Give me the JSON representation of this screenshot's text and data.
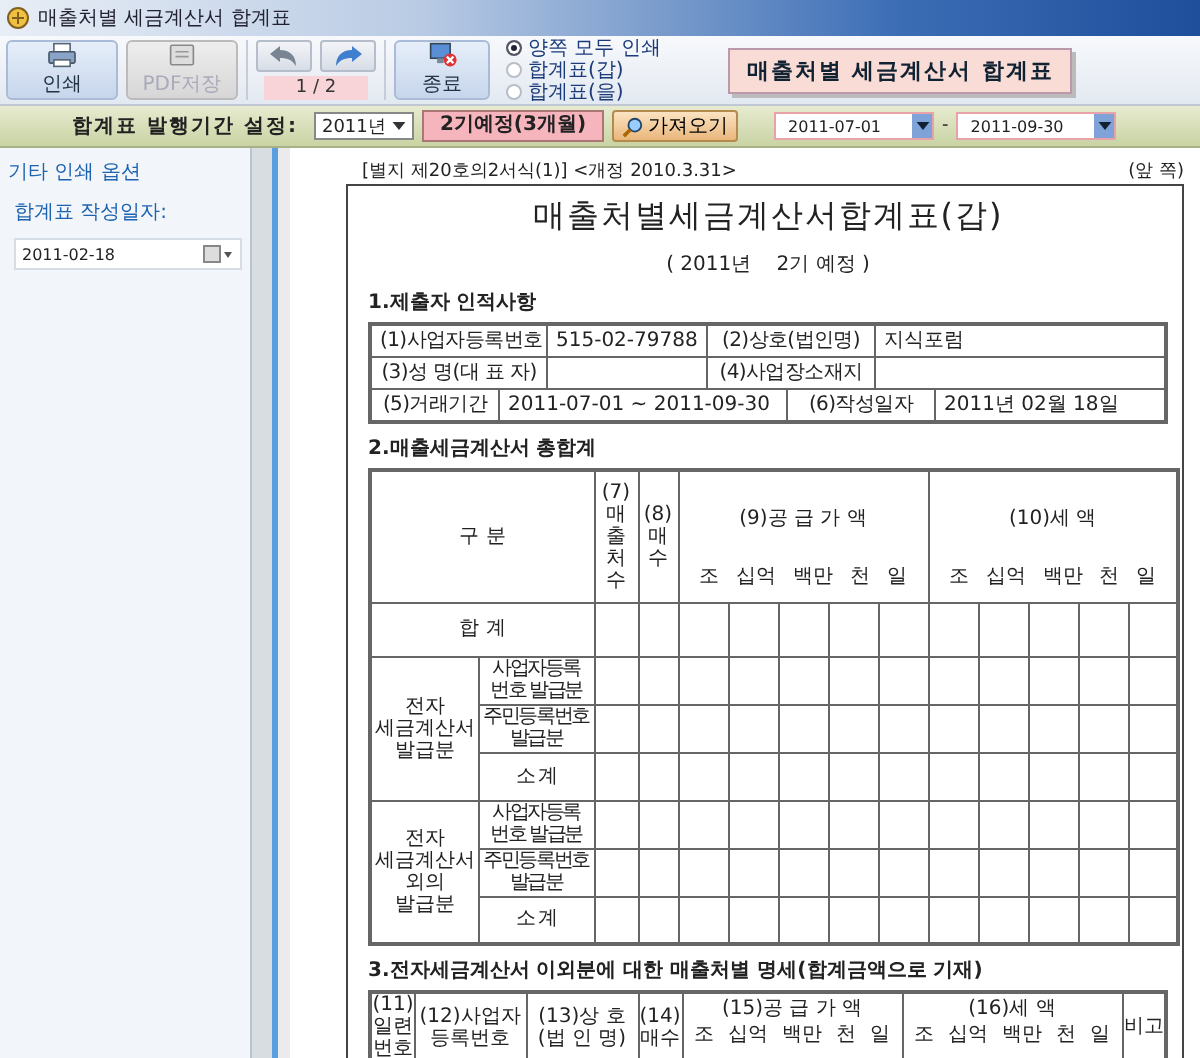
{
  "window": {
    "title": "매출처별 세금계산서 합계표"
  },
  "toolbar": {
    "print_button": {
      "label": "인쇄"
    },
    "pdf_button": {
      "label": "PDF저장",
      "disabled": true
    },
    "page_indicator": "1 / 2",
    "exit_button": {
      "label": "종료"
    },
    "print_options": [
      {
        "label": "양쪽 모두 인쇄",
        "selected": true
      },
      {
        "label": "합계표(갑)",
        "selected": false
      },
      {
        "label": "합계표(을)",
        "selected": false
      }
    ],
    "form_title": "매출처별 세금계산서 합계표"
  },
  "period_bar": {
    "label": "합계표 발행기간 설정:",
    "year": "2011년",
    "period": "2기예정(3개월)",
    "fetch_button": "가져오기",
    "start_date": "2011-07-01",
    "separator": "-",
    "end_date": "2011-09-30"
  },
  "sidebar": {
    "heading": "기타 인쇄 옵션",
    "field_label": "합계표 작성일자:",
    "date_value": "2011-02-18"
  },
  "document": {
    "form_ref": "[별지 제20호의2서식(1)] <개정 2010.3.31>",
    "page_side": "(앞 쪽)",
    "title": "매출처별세금계산서합계표(갑)",
    "subtitle": "( 2011년    2기 예정 )",
    "section1": {
      "heading": "1.제출자 인적사항",
      "rows": [
        {
          "cells": [
            {
              "label": "(1)사업자등록번호",
              "value": "515-02-79788"
            },
            {
              "label": "(2)상호(법인명)",
              "value": "지식포럼"
            }
          ]
        },
        {
          "cells": [
            {
              "label": "(3)성 명(대 표 자)"
            },
            {
              "label": "(4)사업장소재지"
            }
          ]
        },
        {
          "cells": [
            {
              "label": "(5)거래기간",
              "value": "2011-07-01 ~ 2011-09-30"
            },
            {
              "label": "(6)작성일자",
              "value": "2011년 02월 18일"
            }
          ]
        }
      ]
    },
    "section2": {
      "heading": "2.매출세금계산서 총합계",
      "category_header": "구 분",
      "count_header": "(7)매출처수",
      "sheets_header": "(8)매수",
      "supply_header": "(9)공 급 가 액",
      "supply_units": [
        "조",
        "십억",
        "백만",
        "천",
        "일"
      ],
      "tax_header": "(10)세 액",
      "tax_units": [
        "조",
        "십억",
        "백만",
        "천",
        "일"
      ],
      "total_label": "합 계",
      "groups": [
        {
          "label": "전자 세금계산서 발급분",
          "rows": [
            "사업자등록 번호 발급분",
            "주민등록번호 발급분",
            "소 계"
          ]
        },
        {
          "label": "전자 세금계산서 외의 발급분",
          "rows": [
            "사업자등록 번호 발급분",
            "주민등록번호 발급분",
            "소 계"
          ]
        }
      ]
    },
    "section3": {
      "heading": "3.전자세금계산서 이외분에 대한 매출처별 명세(합계금액으로 기재)",
      "serial": "(11)일련번호",
      "business_number": "(12)사업자등록번호",
      "company": "(13)상 호 (법 인 명)",
      "sheets": "(14)매수",
      "supply": "(15)공 급 가 액",
      "supply_units": [
        "조",
        "십억",
        "백만",
        "천",
        "일"
      ],
      "tax": "(16)세 액",
      "tax_units": [
        "조",
        "십억",
        "백만",
        "천",
        "일"
      ],
      "remarks": "비고"
    }
  }
}
